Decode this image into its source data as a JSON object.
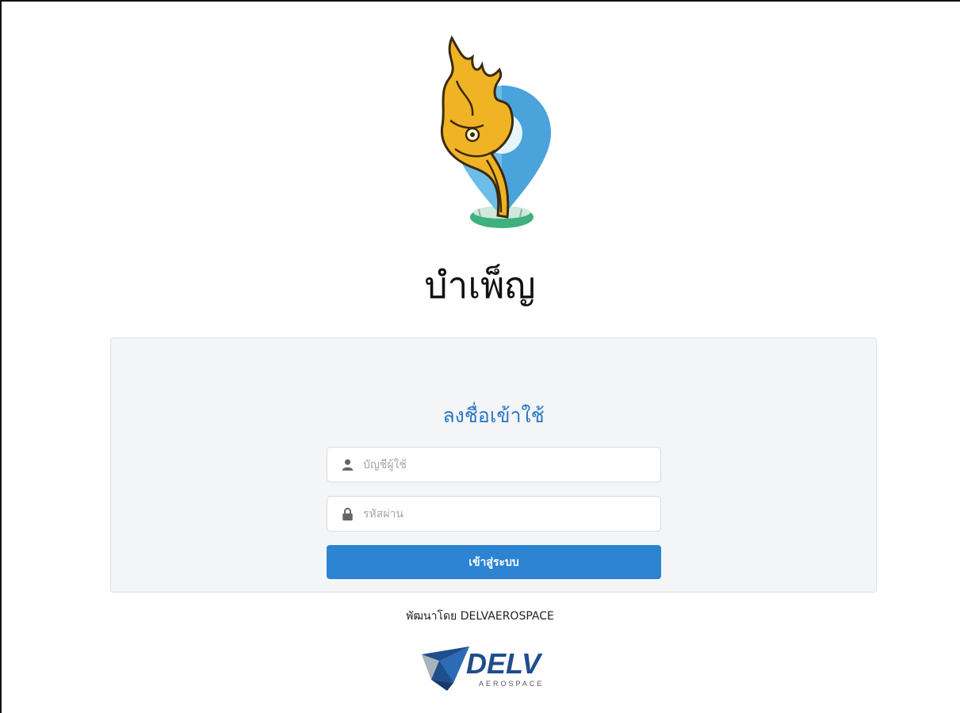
{
  "app": {
    "title": "บำเพ็ญ"
  },
  "login": {
    "heading": "ลงชื่อเข้าใช้",
    "username_placeholder": "บัญชีผู้ใช้",
    "username_value": "",
    "password_placeholder": "รหัสผ่าน",
    "password_value": "",
    "submit_label": "เข้าสู่ระบบ"
  },
  "footer": {
    "credit": "พัฒนาโดย DELVAEROSPACE",
    "logo_brand": "DELV",
    "logo_tagline": "AEROSPACE"
  },
  "icons": {
    "app_logo": "naga-location-pin-icon",
    "username": "user-icon",
    "password": "lock-icon"
  },
  "colors": {
    "accent": "#2b83d1",
    "heading": "#2b78c4",
    "card_bg": "#f3f5f7",
    "logo_gold": "#f0b323",
    "logo_blue": "#5aaee0",
    "logo_green": "#3fb07e",
    "brand_blue": "#1f4e8c"
  }
}
